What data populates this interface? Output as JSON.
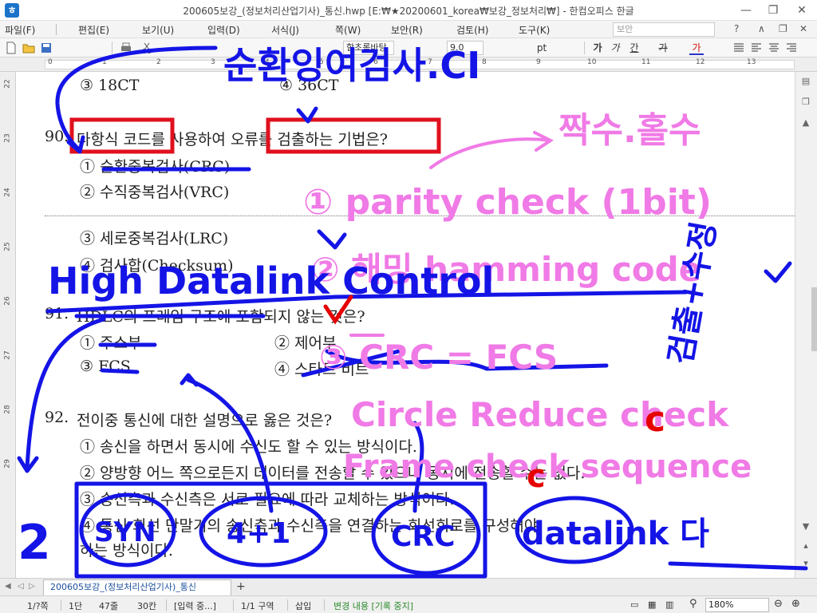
{
  "window": {
    "title": "200605보강_(정보처리산업기사)_통신.hwp [E:₩★20200601_korea₩보강_정보처리₩] - 한컴오피스 한글"
  },
  "menu": {
    "items": [
      "파일(F)",
      "편집(E)",
      "보기(U)",
      "입력(D)",
      "서식(J)",
      "쪽(W)",
      "보안(R)",
      "검토(H)",
      "도구(K)"
    ],
    "search_placeholder": "보안"
  },
  "toolbar": {
    "font_name": "함초롬바탕",
    "font_size": "9.0",
    "font_unit": "pt",
    "bold": "가",
    "italic": "가",
    "underline": "간",
    "strike": "가",
    "color": "가"
  },
  "ruler": {
    "numbers": [
      "0",
      "1",
      "2",
      "3",
      "4",
      "5",
      "6",
      "7",
      "8",
      "9",
      "10",
      "11",
      "12",
      "13"
    ]
  },
  "vruler": {
    "numbers": [
      "22",
      "23",
      "24",
      "25",
      "26",
      "27",
      "28",
      "29"
    ]
  },
  "document": {
    "prev_q_opt3": "③  18CT",
    "prev_q_opt4": "④  36CT",
    "q90_number": "90.",
    "q90_text": "다항식 코드를 사용하여 오류를 검출하는 기법은?",
    "q90_opt1": "①  순환중복검사(CRC)",
    "q90_opt2": "②  수직중복검사(VRC)",
    "q90_opt3": "③  세로중복검사(LRC)",
    "q90_opt4": "④  검사합(Checksum)",
    "q91_number": "91.",
    "q91_text": "HDLC의 프레임 구조에 포함되지 않는 것은?",
    "q91_opt1": "①  주소부",
    "q91_opt2": "②  제어부",
    "q91_opt3": "③  FCS",
    "q91_opt4": "④  스타트 비트",
    "q92_number": "92.",
    "q92_text": "전이중 통신에 대한 설명으로 옳은 것은?",
    "q92_opt1": "①  송신을 하면서 동시에 수신도 할 수 있는 방식이다.",
    "q92_opt2": "②  양방향 어느 쪽으로든지 데이터를 전송할 수 있으나 동시에 전송할 수는 없다.",
    "q92_opt3": "③  송신측과 수신측은 서로 필요에 따라 교체하는 방식이다.",
    "q92_opt4": "④  통신 회선 단말기의 송신측과 수신측을 연결하는 회선회로를 구성해야",
    "q92_opt4b": "    하는 방식이다."
  },
  "annotations": {
    "top_title": "순환잉여검사.CI",
    "parity_header": "짝수.홀수",
    "parity": "① parity check (1bit)",
    "hamming": "② 해밍 hamming code",
    "detect_correct": "검출+수정",
    "hdlc_expansion": "High Datalink Control",
    "crc_fcs": "③ CRC = FCS",
    "crc_expansion": "Circle Reduce check",
    "frame_check": "Frame check sequence",
    "c_mark1": "c",
    "c_mark2": "c",
    "num2": "2",
    "bubble1": "SYN",
    "bubble2": "4+1",
    "bubble3": "CRC",
    "datalink": "datalink 다",
    "check_mark": "v"
  },
  "colors": {
    "blue_ink": "#1414e6",
    "pink_ink": "#f07ae6",
    "red_ink": "#e60000",
    "red_box": "#e0101e"
  },
  "tabs": {
    "doc_tab": "200605보강_(정보처리산업기사)_통신"
  },
  "status": {
    "page": "1/?쪽",
    "section": "1단",
    "line": "47줄",
    "col": "30칸",
    "input_mode": "[입력 중...]",
    "zone": "1/1 구역",
    "insert": "삽입",
    "track": "변경 내용 [기록 중지]",
    "zoom": "180%"
  }
}
